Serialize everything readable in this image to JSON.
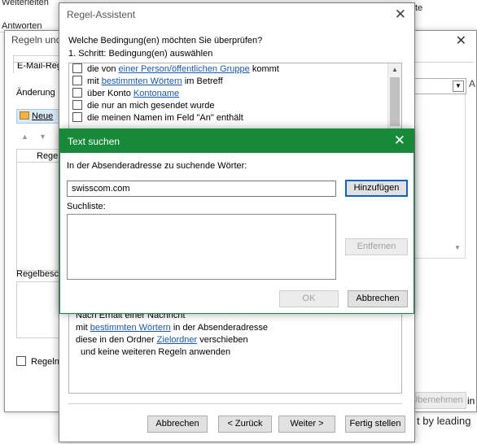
{
  "background": {
    "top_left_1": "Weiterleiten",
    "top_left_2": "Antworten",
    "top_right": "te",
    "rules_window_title": "Regeln und Benachrichtigungen",
    "email_rules_tab": "E-Mail-Regeln",
    "changes_label": "Änderung",
    "new_rule_label": "Neue",
    "column_rule": "Regel",
    "rule_description_label": "Regelbeschreibung",
    "enable_checkbox_label": "Regeln",
    "apply_button": "Übernehmen",
    "bottom_right_text": "t by leading",
    "right_fragment_1": "A",
    "right_fragment_2": "in"
  },
  "wizard": {
    "title": "Regel-Assistent",
    "question": "Welche Bedingung(en) möchten Sie überprüfen?",
    "step": "1. Schritt: Bedingung(en) auswählen",
    "conditions": [
      {
        "pre": "die von ",
        "link": "einer Person/öffentlichen Gruppe",
        "post": " kommt",
        "checked": false
      },
      {
        "pre": "mit ",
        "link": "bestimmten Wörtern",
        "post": " im Betreff",
        "checked": false
      },
      {
        "pre": "über Konto ",
        "link": "Kontoname",
        "post": "",
        "checked": false
      },
      {
        "pre": "die nur an mich gesendet wurde",
        "link": "",
        "post": "",
        "checked": false
      },
      {
        "pre": "die meinen Namen im Feld \"An\" enthält",
        "link": "",
        "post": "",
        "checked": false
      }
    ],
    "description": {
      "line1": "Nach Erhalt einer Nachricht",
      "line2_pre": "mit ",
      "line2_link": "bestimmten Wörtern",
      "line2_post": " in der Absenderadresse",
      "line3_pre": "diese in den Ordner ",
      "line3_link": "Zielordner",
      "line3_post": " verschieben",
      "line4": "und keine weiteren Regeln anwenden"
    },
    "buttons": {
      "cancel": "Abbrechen",
      "back": "< Zurück",
      "next": "Weiter >",
      "finish": "Fertig stellen"
    }
  },
  "text_search": {
    "title": "Text suchen",
    "label": "In der Absenderadresse zu suchende Wörter:",
    "input_value": "swisscom.com",
    "add_button": "Hinzufügen",
    "list_label": "Suchliste:",
    "remove_button": "Entfernen",
    "ok_button": "OK",
    "cancel_button": "Abbrechen",
    "accent_color": "#178a3a"
  }
}
